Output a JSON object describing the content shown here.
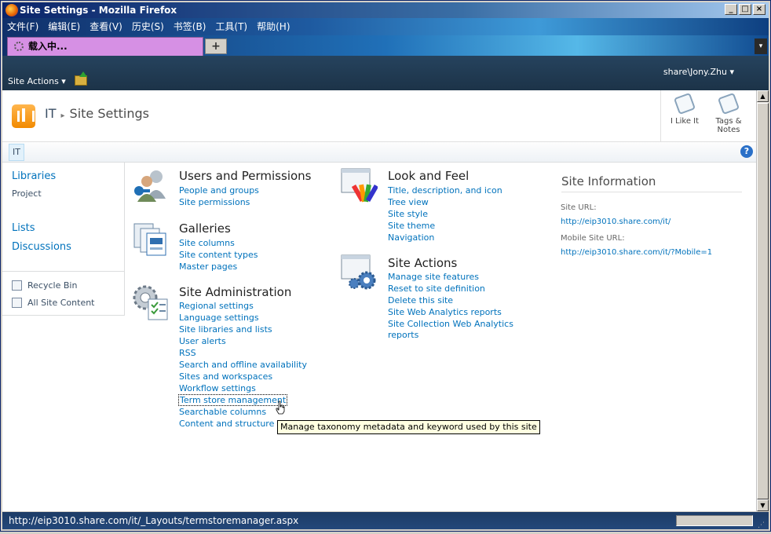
{
  "window": {
    "title": "Site Settings - Mozilla Firefox",
    "min": "_",
    "max": "□",
    "close": "×"
  },
  "menu": [
    "文件(F)",
    "编辑(E)",
    "查看(V)",
    "历史(S)",
    "书签(B)",
    "工具(T)",
    "帮助(H)"
  ],
  "tab": {
    "label": "载入中...",
    "new_tab": "+",
    "dropdown": "▾"
  },
  "ribbon": {
    "site_actions": "Site Actions ▾",
    "user": "share\\Jony.Zhu ▾"
  },
  "breadcrumb": {
    "site": "IT",
    "sep": "▸",
    "page": "Site Settings"
  },
  "social": {
    "i_like_it": "I Like It",
    "tags_notes_1": "Tags &",
    "tags_notes_2": "Notes"
  },
  "topnav": {
    "tab": "IT",
    "help": "?"
  },
  "leftnav": {
    "libraries": "Libraries",
    "project": "Project",
    "lists": "Lists",
    "discussions": "Discussions",
    "recycle_bin": "Recycle Bin",
    "all_site_content": "All Site Content"
  },
  "sections": {
    "users": {
      "title": "Users and Permissions",
      "links": [
        "People and groups",
        "Site permissions"
      ]
    },
    "galleries": {
      "title": "Galleries",
      "links": [
        "Site columns",
        "Site content types",
        "Master pages"
      ]
    },
    "admin": {
      "title": "Site Administration",
      "links": [
        "Regional settings",
        "Language settings",
        "Site libraries and lists",
        "User alerts",
        "RSS",
        "Search and offline availability",
        "Sites and workspaces",
        "Workflow settings",
        "Term store management",
        "Searchable columns",
        "Content and structure"
      ]
    },
    "look": {
      "title": "Look and Feel",
      "links": [
        "Title, description, and icon",
        "Tree view",
        "Site style",
        "Site theme",
        "Navigation"
      ]
    },
    "actions": {
      "title": "Site Actions",
      "links": [
        "Manage site features",
        "Reset to site definition",
        "Delete this site",
        "Site Web Analytics reports",
        "Site Collection Web Analytics",
        "reports"
      ]
    }
  },
  "site_info": {
    "title": "Site Information",
    "url_label": "Site URL:",
    "url": "http://eip3010.share.com/it/",
    "mobile_label": "Mobile Site URL:",
    "mobile_url": "http://eip3010.share.com/it/?Mobile=1"
  },
  "tooltip": "Manage taxonomy metadata and keyword used by this site",
  "status": {
    "url": "http://eip3010.share.com/it/_Layouts/termstoremanager.aspx"
  },
  "scroll": {
    "up": "▲",
    "down": "▼"
  }
}
